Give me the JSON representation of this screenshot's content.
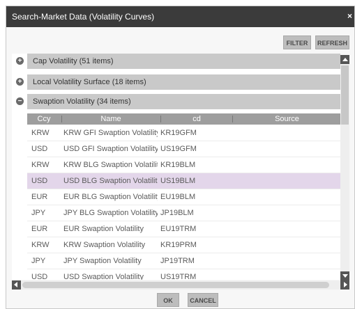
{
  "window": {
    "title": "Search-Market Data (Volatility Curves)",
    "close_label": "×"
  },
  "toolbar": {
    "filter_label": "FILTER",
    "refresh_label": "REFRESH"
  },
  "groups": [
    {
      "label": "Cap Volatility (51 items)",
      "toggle": "+",
      "expanded": false
    },
    {
      "label": "Local Volatility Surface (18 items)",
      "toggle": "+",
      "expanded": false
    },
    {
      "label": "Swaption Volatility (34 items)",
      "toggle": "−",
      "expanded": true
    }
  ],
  "table": {
    "columns": [
      "Ccy",
      "Name",
      "cd",
      "Source"
    ],
    "rows": [
      {
        "ccy": "KRW",
        "name": "KRW GFI Swaption Volatility",
        "cd": "KR19GFM",
        "selected": false
      },
      {
        "ccy": "USD",
        "name": "USD GFI Swaption Volatility",
        "cd": "US19GFM",
        "selected": false
      },
      {
        "ccy": "KRW",
        "name": "KRW BLG Swaption Volatilit",
        "cd": "KR19BLM",
        "selected": false
      },
      {
        "ccy": "USD",
        "name": "USD BLG Swaption Volatilit",
        "cd": "US19BLM",
        "selected": true
      },
      {
        "ccy": "EUR",
        "name": "EUR BLG Swaption Volatility",
        "cd": "EU19BLM",
        "selected": false
      },
      {
        "ccy": "JPY",
        "name": "JPY BLG Swaption Volatility",
        "cd": "JP19BLM",
        "selected": false
      },
      {
        "ccy": "EUR",
        "name": "EUR Swaption Volatility",
        "cd": "EU19TRM",
        "selected": false
      },
      {
        "ccy": "KRW",
        "name": "KRW Swaption Volatility",
        "cd": "KR19PRM",
        "selected": false
      },
      {
        "ccy": "JPY",
        "name": "JPY Swaption Volatility",
        "cd": "JP19TRM",
        "selected": false
      },
      {
        "ccy": "USD",
        "name": "USD Swaption Volatility",
        "cd": "US19TRM",
        "selected": false
      }
    ]
  },
  "footer": {
    "ok_label": "OK",
    "cancel_label": "CANCEL"
  },
  "colors": {
    "titlebar": "#3b3b3b",
    "group_bar": "#c9c9c9",
    "column_header": "#9e9e9e",
    "selected_row": "#e3d6ea"
  }
}
